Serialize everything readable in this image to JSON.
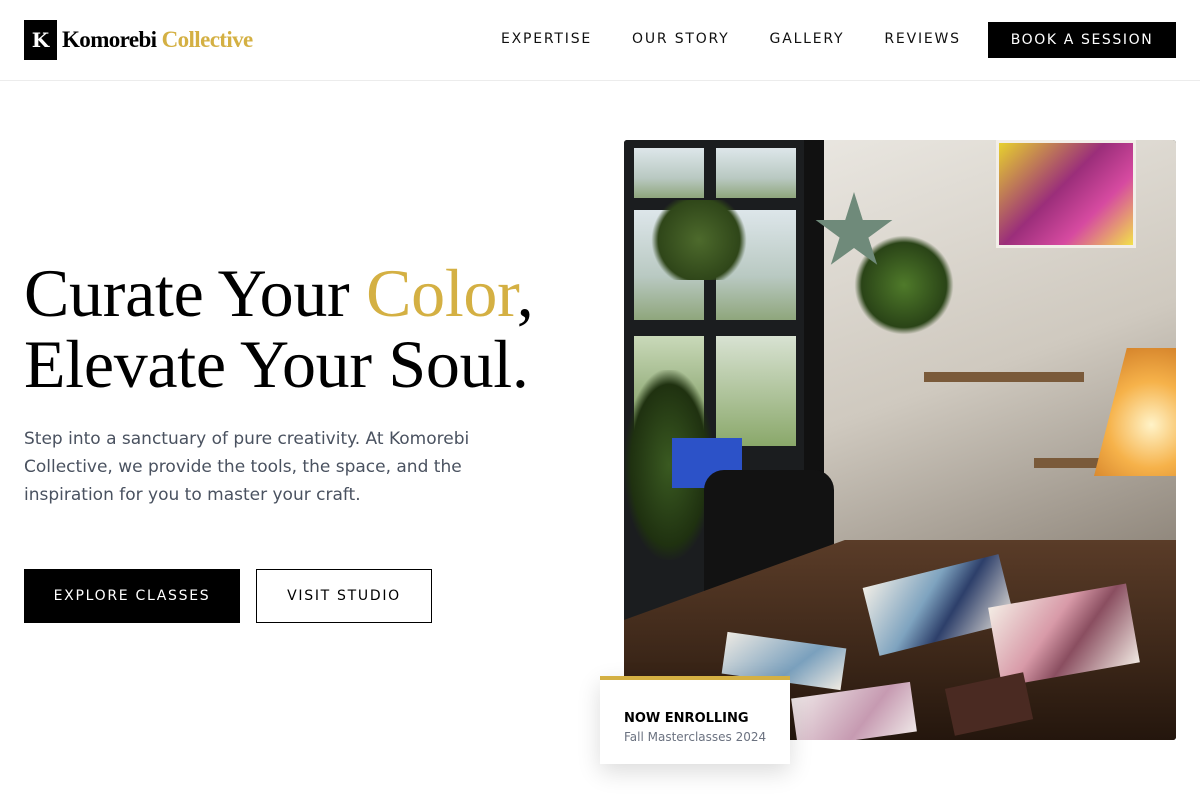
{
  "brand": {
    "mark": "K",
    "name_primary": "Komorebi",
    "name_accent": "Collective",
    "accent_color": "#d4b043"
  },
  "nav": {
    "items": [
      {
        "label": "EXPERTISE"
      },
      {
        "label": "OUR STORY"
      },
      {
        "label": "GALLERY"
      },
      {
        "label": "REVIEWS"
      }
    ],
    "cta_label": "BOOK A SESSION"
  },
  "hero": {
    "headline_part1": "Curate Your ",
    "headline_accent": "Color",
    "headline_part2": ",",
    "headline_line2": "Elevate Your Soul.",
    "intro": "Step into a sanctuary of pure creativity. At Komorebi Collective, we provide the tools, the space, and the inspiration for you to master your craft.",
    "primary_button": "EXPLORE CLASSES",
    "secondary_button": "VISIT STUDIO"
  },
  "image": {
    "icon": "studio-photo"
  },
  "badge": {
    "title": "NOW ENROLLING",
    "subtitle": "Fall Masterclasses 2024"
  }
}
